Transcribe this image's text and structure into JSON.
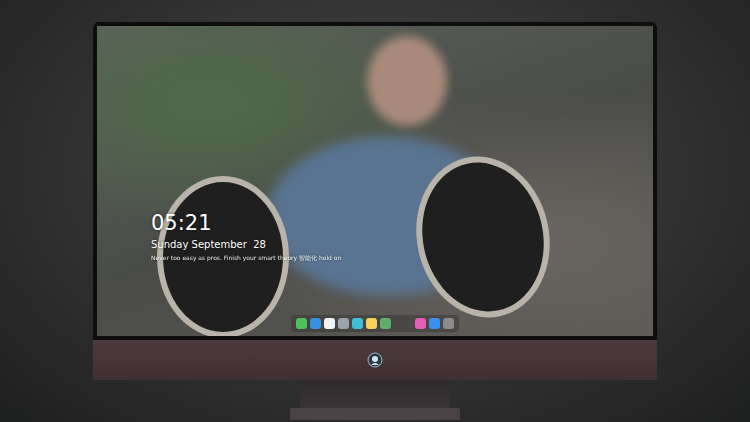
{
  "lock_screen": {
    "time": "05:21",
    "date": "Sunday September  28",
    "caption": "Never too easy as pros. Finish your smart theory 智能化 hold on"
  },
  "dock": {
    "items": [
      {
        "kind": "app",
        "color": "#4cc35a"
      },
      {
        "kind": "app",
        "color": "#3b8fe0"
      },
      {
        "kind": "app",
        "color": "#f2f2f2"
      },
      {
        "kind": "app",
        "color": "#9aa3ad"
      },
      {
        "kind": "app",
        "color": "#3fc2d8"
      },
      {
        "kind": "app",
        "color": "#f3d35a"
      },
      {
        "kind": "app",
        "color": "#5fae6b"
      },
      {
        "kind": "gap",
        "color": "#000000"
      },
      {
        "kind": "app",
        "color": "#e25fb5"
      },
      {
        "kind": "app",
        "color": "#3d8ff0"
      },
      {
        "kind": "app",
        "color": "#8c8c8c"
      }
    ]
  }
}
